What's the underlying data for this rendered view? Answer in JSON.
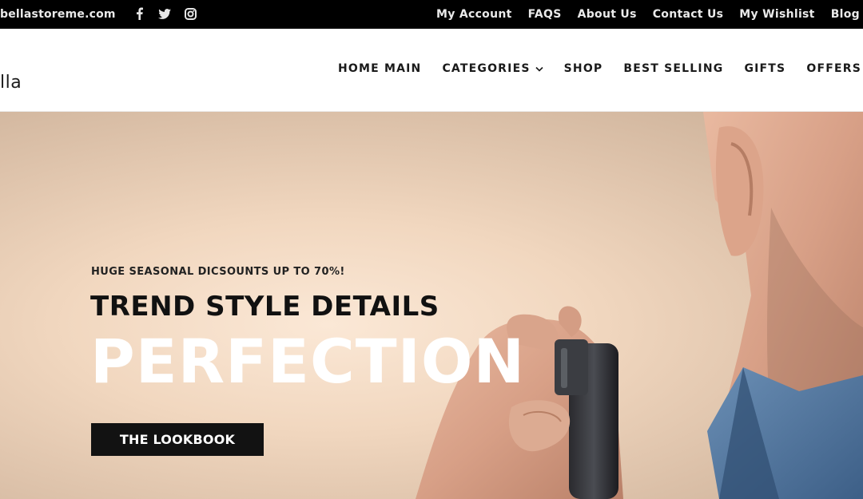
{
  "topbar": {
    "site": "bellastoreme.com",
    "social": [
      {
        "icon": "facebook-icon"
      },
      {
        "icon": "twitter-icon"
      },
      {
        "icon": "instagram-icon"
      }
    ],
    "links": [
      "My Account",
      "FAQS",
      "About Us",
      "Contact Us",
      "My Wishlist",
      "Blog"
    ]
  },
  "header": {
    "logo": "lla",
    "nav": [
      "HOME MAIN",
      "CATEGORIES",
      "SHOP",
      "BEST SELLING",
      "GIFTS",
      "OFFERS"
    ]
  },
  "hero": {
    "subtitle": "HUGE SEASONAL DICSOUNTS UP TO 70%!",
    "title_line1": "TREND STYLE DETAILS",
    "title_line2": "PERFECTION",
    "cta_label": "THE LOOKBOOK"
  },
  "colors": {
    "topbar_bg": "#000000",
    "cta_bg": "#121212",
    "hero_bg": "#f1d7bf"
  }
}
